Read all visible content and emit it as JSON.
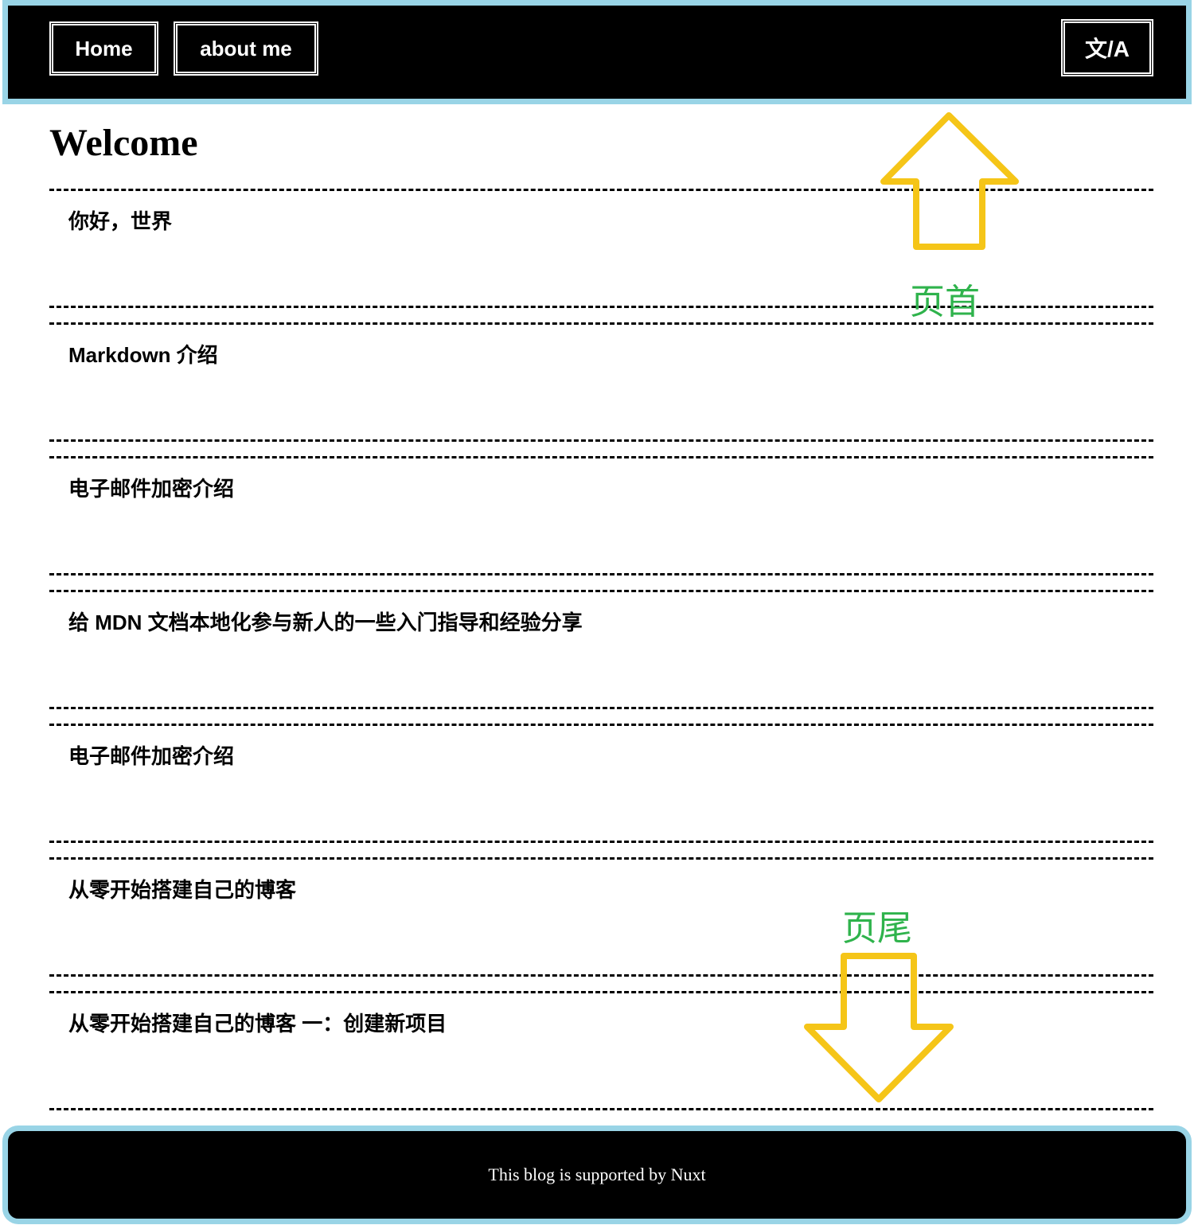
{
  "header": {
    "nav": [
      {
        "label": "Home"
      },
      {
        "label": "about me"
      }
    ],
    "lang_toggle": "文/A"
  },
  "main": {
    "title": "Welcome",
    "posts": [
      {
        "title": "你好，世界"
      },
      {
        "title": "Markdown 介绍"
      },
      {
        "title": "电子邮件加密介绍"
      },
      {
        "title": "给 MDN 文档本地化参与新人的一些入门指导和经验分享"
      },
      {
        "title": "电子邮件加密介绍"
      },
      {
        "title": "从零开始搭建自己的博客"
      },
      {
        "title": "从零开始搭建自己的博客 一：创建新项目"
      }
    ]
  },
  "footer": {
    "text": "This blog is supported by Nuxt"
  },
  "annotations": {
    "header_label": "页首",
    "footer_label": "页尾",
    "arrow_color": "#f5c518",
    "label_color": "#2fb34c",
    "frame_color": "#99d4e6"
  }
}
